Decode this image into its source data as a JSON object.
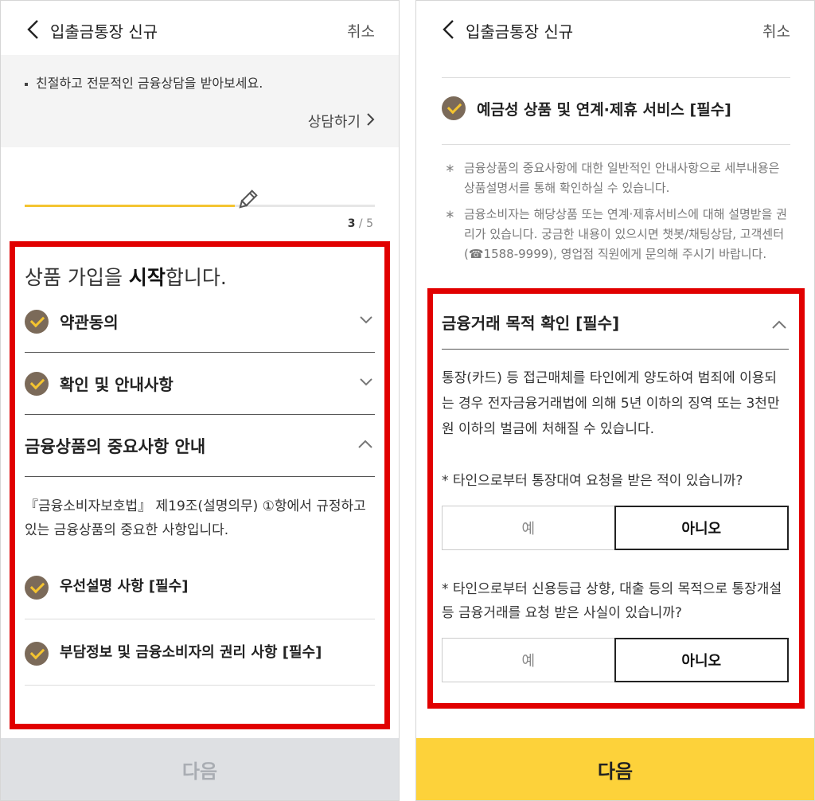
{
  "left": {
    "header": {
      "title": "입출금통장 신규",
      "cancel": "취소"
    },
    "consult": {
      "text": "친절하고 전문적인 금융상담을 받아보세요.",
      "link": "상담하기"
    },
    "progress": {
      "current": "3",
      "separator": "/",
      "total": "5",
      "fill_fraction": 0.6
    },
    "intro": {
      "prefix": "상품 가입을 ",
      "bold": "시작",
      "suffix": "합니다."
    },
    "rows": [
      {
        "label": "약관동의"
      },
      {
        "label": "확인 및 안내사항"
      }
    ],
    "section": {
      "title": "금융상품의 중요사항 안내",
      "description": "『금융소비자보호법』 제19조(설명의무) ①항에서 규정하고 있는 금융상품의 중요한 사항입니다.",
      "items": [
        {
          "label": "우선설명 사항 [필수]"
        },
        {
          "label": "부담정보 및 금융소비자의 권리 사항 [필수]"
        }
      ]
    },
    "next_button": "다음"
  },
  "right": {
    "header": {
      "title": "입출금통장 신규",
      "cancel": "취소"
    },
    "item": {
      "label": "예금성 상품 및 연계·제휴 서비스 [필수]"
    },
    "notes": [
      "금융상품의 중요사항에 대한 일반적인 안내사항으로 세부내용은 상품설명서를 통해 확인하실 수 있습니다.",
      "금융소비자는 해당상품 또는 연계·제휴서비스에 대해 설명받을 권리가 있습니다. 궁금한 내용이 있으시면 챗봇/채팅상담, 고객센터 (☎1588-9999), 영업점 직원에게 문의해 주시기 바랍니다."
    ],
    "note_marker": "∗",
    "purpose": {
      "title": "금융거래 목적 확인 [필수]",
      "description": "통장(카드) 등 접근매체를 타인에게 양도하여 범죄에 이용되는 경우 전자금융거래법에 의해 5년 이하의 징역 또는 3천만원 이하의 벌금에 처해질 수 있습니다.",
      "questions": [
        {
          "text": "* 타인으로부터 통장대여 요청을 받은 적이 있습니까?",
          "yes": "예",
          "no": "아니오",
          "selected": "아니오"
        },
        {
          "text": "* 타인으로부터 신용등급 상향, 대출 등의 목적으로 통장개설 등 금융거래를 요청 받은 사실이 있습니까?",
          "yes": "예",
          "no": "아니오",
          "selected": "아니오"
        }
      ]
    },
    "next_button": "다음"
  },
  "colors": {
    "accent_yellow": "#fdd23a",
    "check_brown": "#7b6a59",
    "highlight_red": "#e10000",
    "disabled_gray": "#dee0e3"
  },
  "icons": [
    "chevron-left-icon",
    "chevron-right-icon",
    "pencil-icon",
    "check-circle-icon",
    "chevron-down-icon",
    "chevron-up-icon"
  ]
}
